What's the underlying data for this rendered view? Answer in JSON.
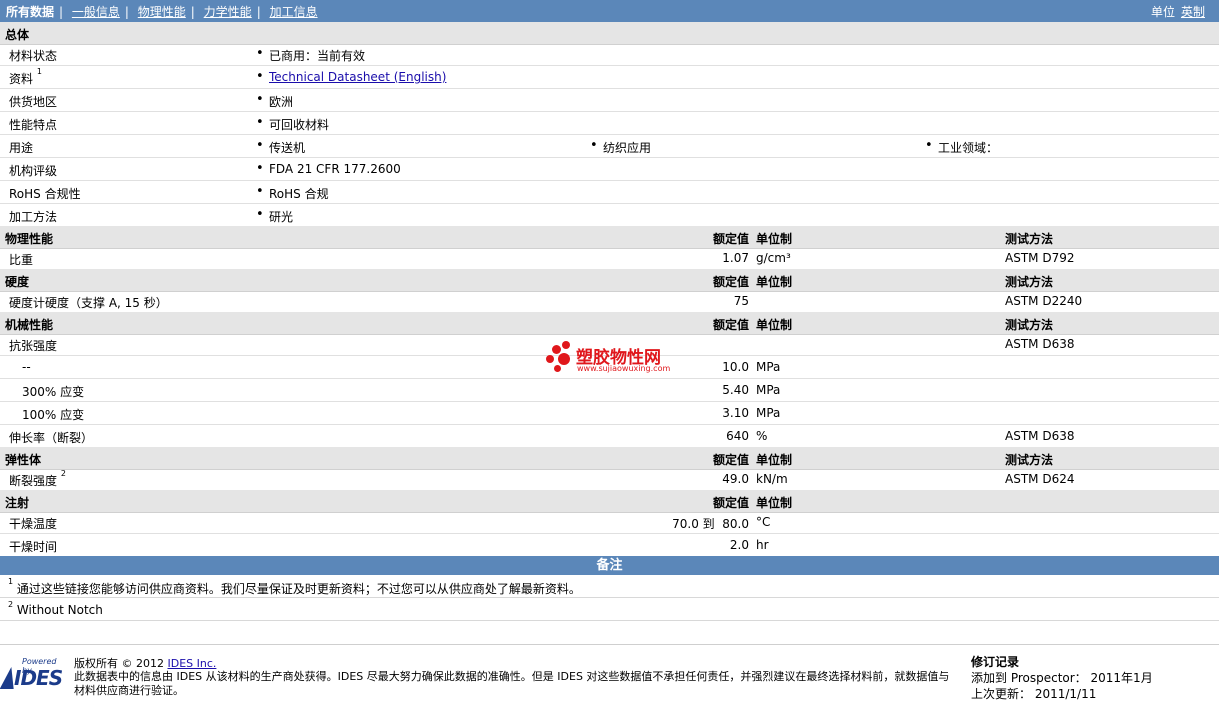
{
  "nav": {
    "items": [
      "所有数据",
      "一般信息",
      "物理性能",
      "力学性能",
      "加工信息"
    ],
    "unit_label": "单位",
    "unit_value": "英制"
  },
  "general": {
    "title": "总体",
    "rows": [
      {
        "label": "材料状态",
        "values": [
          "已商用：当前有效"
        ]
      },
      {
        "label": "资料",
        "sup": "1",
        "values": [
          "Technical Datasheet (English)"
        ]
      },
      {
        "label": "供货地区",
        "values": [
          "欧洲"
        ]
      },
      {
        "label": "性能特点",
        "values": [
          "可回收材料"
        ]
      },
      {
        "label": "用途",
        "values": [
          "传送机",
          "纺织应用",
          "工业领域："
        ]
      },
      {
        "label": "机构评级",
        "values": [
          "FDA 21 CFR 177.2600"
        ]
      },
      {
        "label": "RoHS 合规性",
        "values": [
          "RoHS 合规"
        ]
      },
      {
        "label": "加工方法",
        "values": [
          "研光"
        ]
      }
    ]
  },
  "headers": {
    "rated": "额定值",
    "unit": "单位制",
    "method": "测试方法"
  },
  "physical": {
    "title": "物理性能",
    "rows": [
      {
        "label": "比重",
        "value": "1.07",
        "unit": "g/cm³",
        "method": "ASTM D792"
      }
    ]
  },
  "hardness": {
    "title": "硬度",
    "rows": [
      {
        "label": "硬度计硬度（支撑 A, 15 秒）",
        "value": "75",
        "unit": "",
        "method": "ASTM D2240"
      }
    ]
  },
  "mechanical": {
    "title": "机械性能",
    "rows": [
      {
        "label": "抗张强度",
        "value": "",
        "unit": "",
        "method": "ASTM D638"
      },
      {
        "label": "--",
        "value": "10.0",
        "unit": "MPa",
        "method": ""
      },
      {
        "label": "300% 应变",
        "value": "5.40",
        "unit": "MPa",
        "method": ""
      },
      {
        "label": "100% 应变",
        "value": "3.10",
        "unit": "MPa",
        "method": ""
      },
      {
        "label": "伸长率（断裂）",
        "value": "640",
        "unit": "%",
        "method": "ASTM D638"
      }
    ]
  },
  "elastomer": {
    "title": "弹性体",
    "rows": [
      {
        "label": "断裂强度",
        "sup": "2",
        "value": "49.0",
        "unit": "kN/m",
        "method": "ASTM D624"
      }
    ]
  },
  "injection": {
    "title": "注射",
    "rows": [
      {
        "label": "干燥温度",
        "value": "70.0 到  80.0",
        "unit": "°C"
      },
      {
        "label": "干燥时间",
        "value": "2.0",
        "unit": "hr"
      }
    ]
  },
  "notes": {
    "title": "备注",
    "items": [
      {
        "num": "1",
        "text": "通过这些链接您能够访问供应商资料。我们尽量保证及时更新资料；不过您可以从供应商处了解最新资料。"
      },
      {
        "num": "2",
        "text": "Without Notch"
      }
    ]
  },
  "footer": {
    "logo_powered": "Powered by",
    "logo_word": "IDES",
    "copyright_prefix": "版权所有 © 2012",
    "copyright_link": "IDES Inc.",
    "disclaimer": "此数据表中的信息由 IDES 从该材料的生产商处获得。IDES 尽最大努力确保此数据的准确性。但是 IDES 对这些数据值不承担任何责任，并强烈建议在最终选择材料前，就数据值与材料供应商进行验证。",
    "revision_title": "修订记录",
    "added_label": "添加到 Prospector：",
    "added_value": "2011年1月",
    "updated_label": "上次更新：",
    "updated_value": "2011/1/11"
  },
  "watermark": {
    "title": "塑胶物性网",
    "url": "www.sujiaowuxing.com"
  },
  "colors": {
    "nav_bg": "#5b87b9",
    "section_bg": "#e5e5e5",
    "link": "#1a0dab",
    "watermark": "#e0171b"
  }
}
